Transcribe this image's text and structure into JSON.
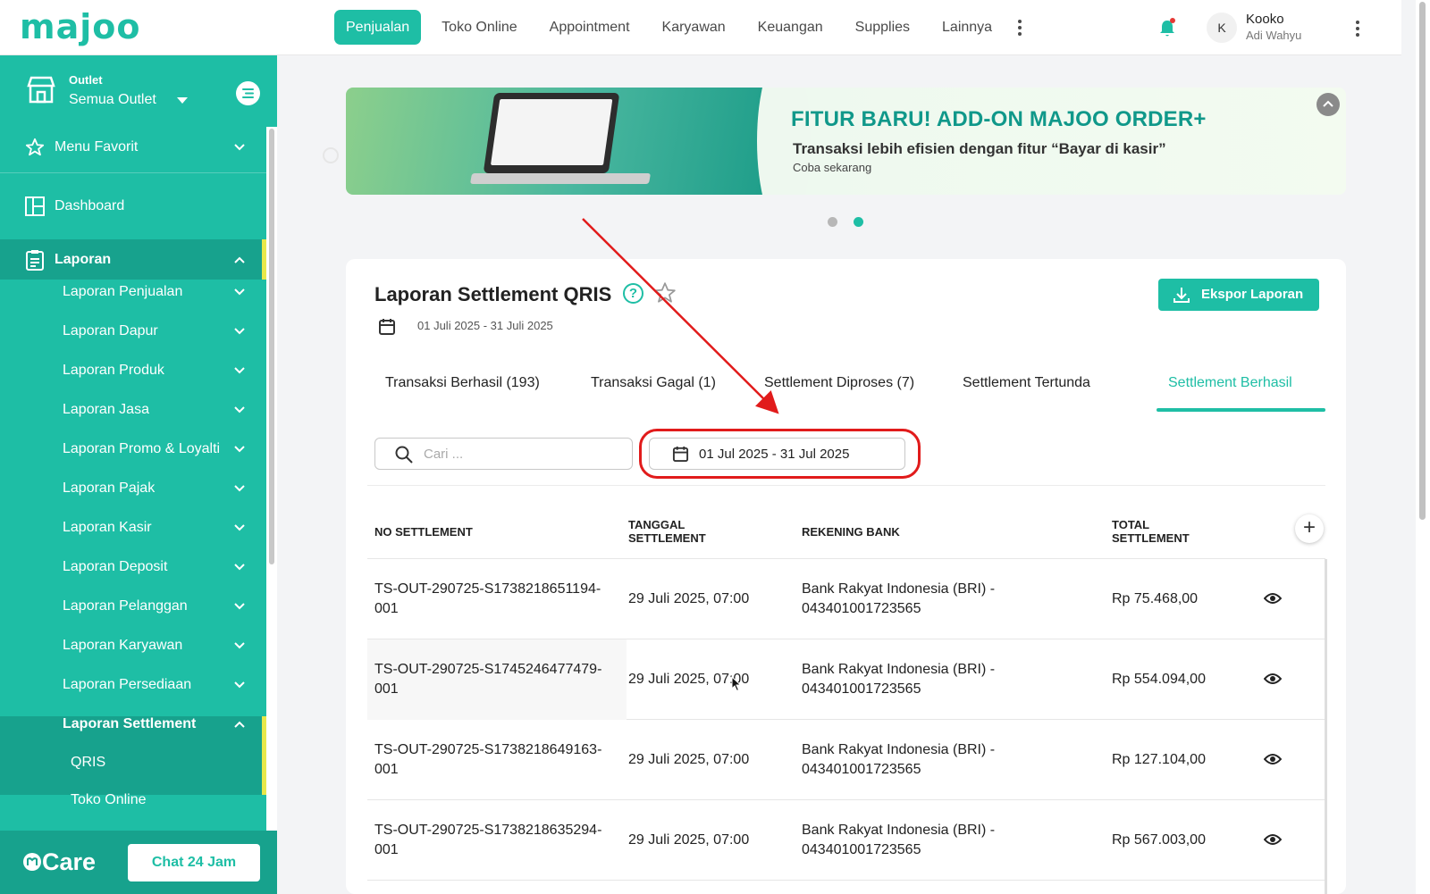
{
  "app": {
    "logo": "majoo"
  },
  "topnav": {
    "items": [
      {
        "label": "Penjualan",
        "active": true
      },
      {
        "label": "Toko Online",
        "active": false
      },
      {
        "label": "Appointment",
        "active": false
      },
      {
        "label": "Karyawan",
        "active": false
      },
      {
        "label": "Keuangan",
        "active": false
      },
      {
        "label": "Supplies",
        "active": false
      },
      {
        "label": "Lainnya",
        "active": false
      }
    ],
    "user": {
      "initial": "K",
      "name": "Kooko",
      "subtitle": "Adi Wahyu"
    }
  },
  "sidebar": {
    "outlet_label": "Outlet",
    "outlet_value": "Semua Outlet",
    "favorite": "Menu Favorit",
    "dashboard": "Dashboard",
    "laporan": "Laporan",
    "sub_items": [
      "Laporan Penjualan",
      "Laporan Dapur",
      "Laporan Produk",
      "Laporan Jasa",
      "Laporan Promo & Loyalti",
      "Laporan Pajak",
      "Laporan Kasir",
      "Laporan Deposit",
      "Laporan Pelanggan",
      "Laporan Karyawan",
      "Laporan Persediaan"
    ],
    "settlement": "Laporan Settlement",
    "settlement_children": [
      "QRIS",
      "Toko Online"
    ],
    "care_label": "Care",
    "chat_button": "Chat 24 Jam"
  },
  "banner": {
    "headline": "FITUR BARU! ADD-ON MAJOO ORDER+",
    "subline": "Transaksi lebih efisien dengan fitur “Bayar di kasir”",
    "cta": "Coba sekarang",
    "active_slide": 2,
    "slide_count": 2
  },
  "report": {
    "title": "Laporan Settlement QRIS",
    "help": "?",
    "period": "01 Juli 2025 - 31 Juli 2025",
    "export_label": "Ekspor Laporan",
    "tabs": [
      "Transaksi Berhasil (193)",
      "Transaksi Gagal (1)",
      "Settlement Diproses (7)",
      "Settlement Tertunda",
      "Settlement Berhasil"
    ],
    "active_tab": "Settlement Berhasil",
    "search_placeholder": "Cari ...",
    "date_range": "01 Jul 2025 - 31 Jul 2025",
    "columns": {
      "no": "NO SETTLEMENT",
      "date_1": "TANGGAL",
      "date_2": "SETTLEMENT",
      "bank": "REKENING BANK",
      "total_1": "TOTAL",
      "total_2": "SETTLEMENT"
    },
    "rows": [
      {
        "no_1": "TS-OUT-290725-S1738218651194-",
        "no_2": "001",
        "date": "29 Juli 2025, 07:00",
        "bank_1": "Bank Rakyat Indonesia (BRI) -",
        "bank_2": "043401001723565",
        "total": "Rp 75.468,00"
      },
      {
        "no_1": "TS-OUT-290725-S1745246477479-",
        "no_2": "001",
        "date": "29 Juli 2025, 07:00",
        "bank_1": "Bank Rakyat Indonesia (BRI) -",
        "bank_2": "043401001723565",
        "total": "Rp 554.094,00"
      },
      {
        "no_1": "TS-OUT-290725-S1738218649163-",
        "no_2": "001",
        "date": "29 Juli 2025, 07:00",
        "bank_1": "Bank Rakyat Indonesia (BRI) -",
        "bank_2": "043401001723565",
        "total": "Rp 127.104,00"
      },
      {
        "no_1": "TS-OUT-290725-S1738218635294-",
        "no_2": "001",
        "date": "29 Juli 2025, 07:00",
        "bank_1": "Bank Rakyat Indonesia (BRI) -",
        "bank_2": "043401001723565",
        "total": "Rp 567.003,00"
      }
    ]
  },
  "colors": {
    "brand": "#1ebea5",
    "sidebar_active": "#17a28d",
    "annotation": "#e11b1b",
    "active_marker": "#e8e84a"
  }
}
